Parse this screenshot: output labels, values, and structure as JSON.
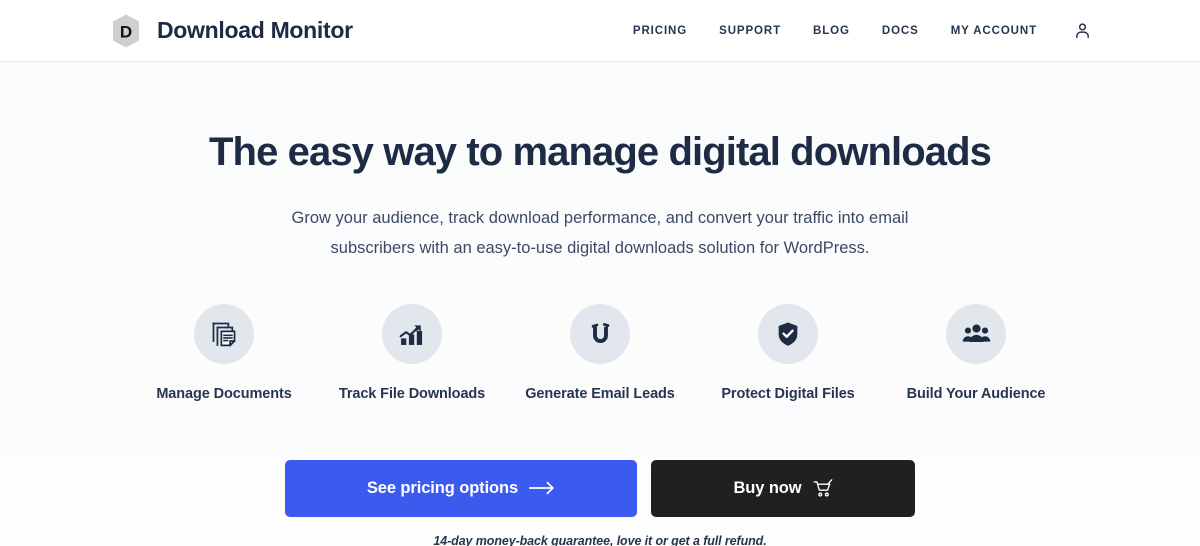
{
  "header": {
    "brand": {
      "mark_letter": "D",
      "mark_icon": "hexagon-badge-icon",
      "name": "Download Monitor"
    },
    "nav": [
      {
        "label": "PRICING",
        "name": "nav-link-pricing"
      },
      {
        "label": "SUPPORT",
        "name": "nav-link-support"
      },
      {
        "label": "BLOG",
        "name": "nav-link-blog"
      },
      {
        "label": "DOCS",
        "name": "nav-link-docs"
      },
      {
        "label": "MY ACCOUNT",
        "name": "nav-link-my-account"
      }
    ],
    "account_icon": "person-icon"
  },
  "hero": {
    "title": "The easy way to manage digital downloads",
    "subtitle_line1": "Grow your audience, track download performance, and convert your traffic into email",
    "subtitle_line2": "subscribers with an easy-to-use digital downloads solution for WordPress."
  },
  "features": [
    {
      "label": "Manage Documents",
      "icon": "documents-stack-icon"
    },
    {
      "label": "Track File Downloads",
      "icon": "bar-chart-trend-icon"
    },
    {
      "label": "Generate Email Leads",
      "icon": "magnet-icon"
    },
    {
      "label": "Protect Digital Files",
      "icon": "shield-check-icon"
    },
    {
      "label": "Build Your Audience",
      "icon": "people-group-icon"
    }
  ],
  "cta": {
    "primary_label": "See pricing options",
    "primary_icon": "arrow-right-icon",
    "secondary_label": "Buy now",
    "secondary_icon": "shopping-cart-icon",
    "guarantee": "14-day money-back guarantee, love it or get a full refund."
  },
  "colors": {
    "accent_blue": "#3B5BEE",
    "dark_button": "#202020",
    "navy_text": "#1D2B45",
    "icon_circle": "#E1E7ED",
    "header_border": "#E3E8EF"
  }
}
